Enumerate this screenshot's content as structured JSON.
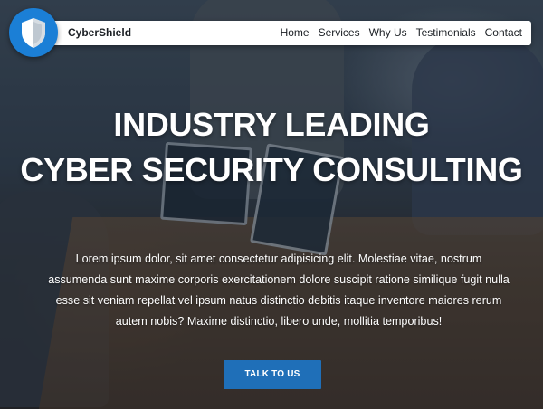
{
  "brand": {
    "name": "CyberShield",
    "logo_icon": "shield-icon",
    "logo_color": "#1b7fd6"
  },
  "nav": {
    "items": [
      {
        "label": "Home"
      },
      {
        "label": "Services"
      },
      {
        "label": "Why Us"
      },
      {
        "label": "Testimonials"
      },
      {
        "label": "Contact"
      }
    ]
  },
  "hero": {
    "headline_line1": "INDUSTRY LEADING",
    "headline_line2": "CYBER SECURITY CONSULTING",
    "description": "Lorem ipsum dolor, sit amet consectetur adipisicing elit. Molestiae vitae, nostrum assumenda sunt maxime corporis exercitationem dolore suscipit ratione similique fugit nulla esse sit veniam repellat vel ipsum natus distinctio debitis itaque inventore maiores rerum autem nobis? Maxime distinctio, libero unde, mollitia temporibus!",
    "cta_label": "TALK TO US",
    "cta_color": "#1f6fb8"
  }
}
